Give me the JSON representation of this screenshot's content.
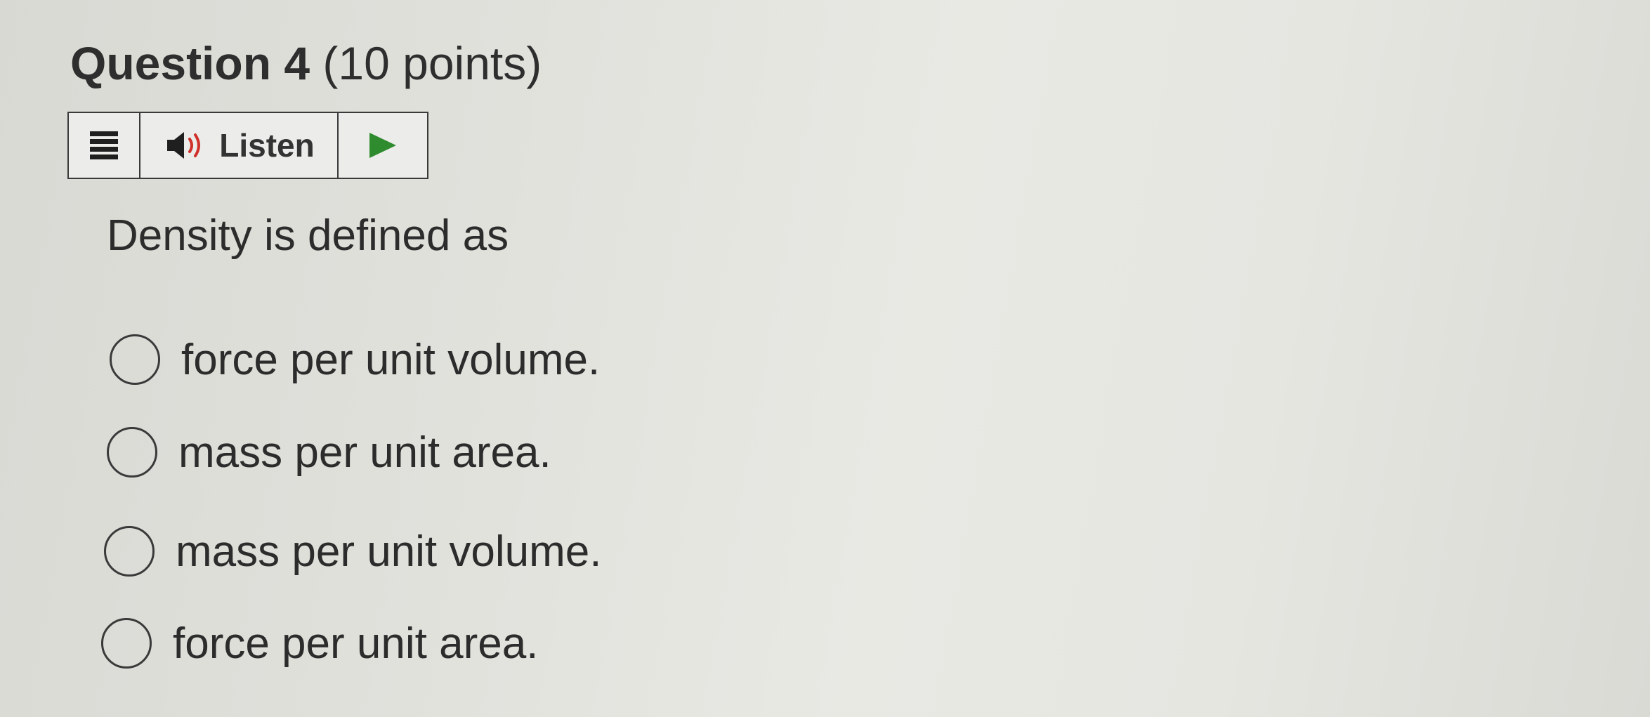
{
  "question": {
    "title": "Question 4",
    "points": "(10 points)",
    "prompt": "Density is defined as"
  },
  "toolbar": {
    "listen_label": "Listen",
    "icons": {
      "menu": "menu-icon",
      "speaker": "speaker-icon",
      "play": "play-icon"
    },
    "colors": {
      "speaker_wave": "#d0302a",
      "play": "#2e8b2e"
    }
  },
  "options": [
    {
      "label": "force per unit volume.",
      "selected": false
    },
    {
      "label": "mass per unit area.",
      "selected": false
    },
    {
      "label": "mass per unit volume.",
      "selected": false
    },
    {
      "label": "force per unit area.",
      "selected": false
    }
  ]
}
